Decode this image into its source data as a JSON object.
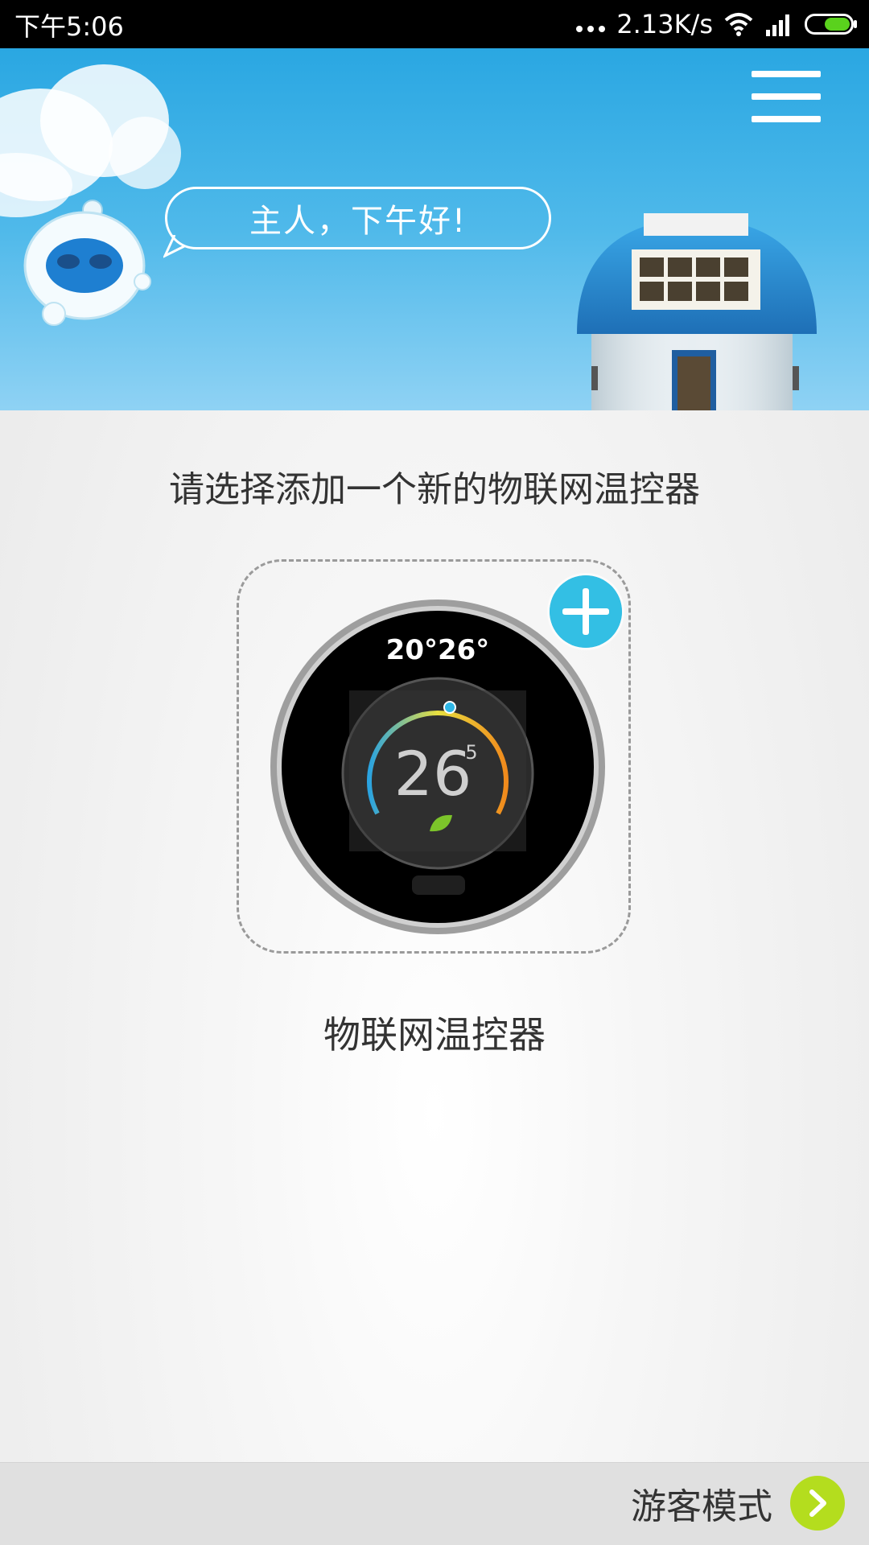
{
  "status_bar": {
    "time": "下午5:06",
    "network_speed": "2.13K/s",
    "icons": [
      "more-dots-icon",
      "wifi-icon",
      "signal-icon",
      "battery-icon"
    ]
  },
  "header": {
    "greeting": "主人，下午好!",
    "menu_icon": "hamburger-menu-icon"
  },
  "main": {
    "prompt": "请选择添加一个新的物联网温控器",
    "device": {
      "name": "物联网温控器",
      "display_top": "20°26°",
      "display_temp_main": "26",
      "display_temp_decimal": "5",
      "add_icon": "plus-icon"
    }
  },
  "footer": {
    "guest_mode_label": "游客模式",
    "arrow_icon": "chevron-right-icon"
  },
  "colors": {
    "header_blue": "#2aa7e2",
    "add_button": "#33bfe4",
    "guest_arrow": "#b4dd1e"
  }
}
